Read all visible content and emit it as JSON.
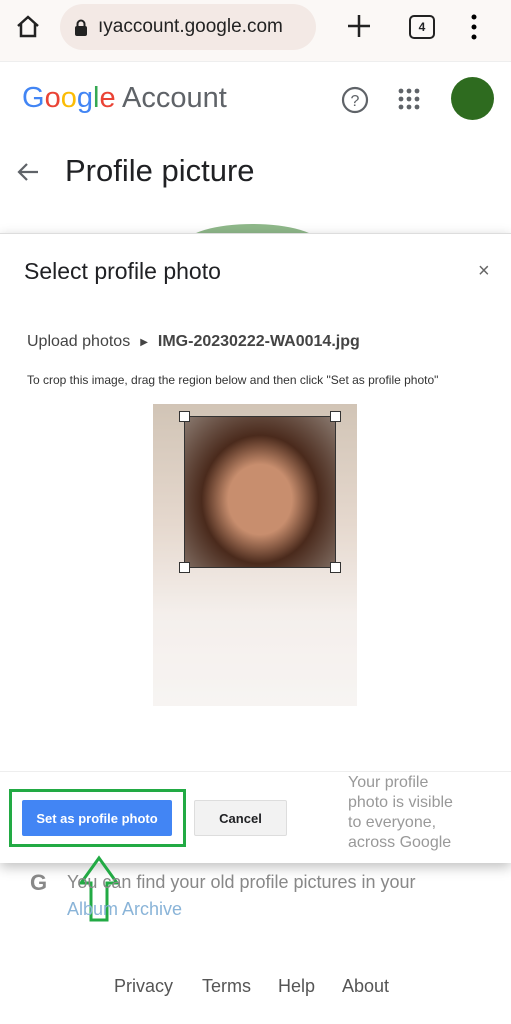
{
  "browser": {
    "url": "ıyaccount.google.com",
    "tab_count": "4",
    "icons": [
      "home-icon",
      "lock-icon",
      "plus-icon",
      "tabs-icon",
      "more-vert-icon"
    ]
  },
  "header": {
    "logo_letters": [
      "G",
      "o",
      "o",
      "g",
      "l",
      "e"
    ],
    "logo_colors": [
      "#4285f4",
      "#ea4335",
      "#fbbc05",
      "#4285f4",
      "#34a853",
      "#ea4335"
    ],
    "product": "Account",
    "avatar_color": "#2e6b1f"
  },
  "page": {
    "title": "Profile picture"
  },
  "dialog": {
    "title": "Select profile photo",
    "breadcrumb_root": "Upload photos",
    "file_name": "IMG-20230222-WA0014.jpg",
    "instructions": "To crop this image, drag the region below and then click \"Set as profile photo\"",
    "set_button": "Set as profile photo",
    "cancel_button": "Cancel",
    "visibility_note": "Your profile photo is visible to everyone, across Google"
  },
  "album": {
    "text": "You can find your old profile pictures in your ",
    "link": "Album Archive"
  },
  "footer": {
    "links": [
      "Privacy",
      "Terms",
      "Help",
      "About"
    ]
  },
  "annotation_color": "#22aa44"
}
